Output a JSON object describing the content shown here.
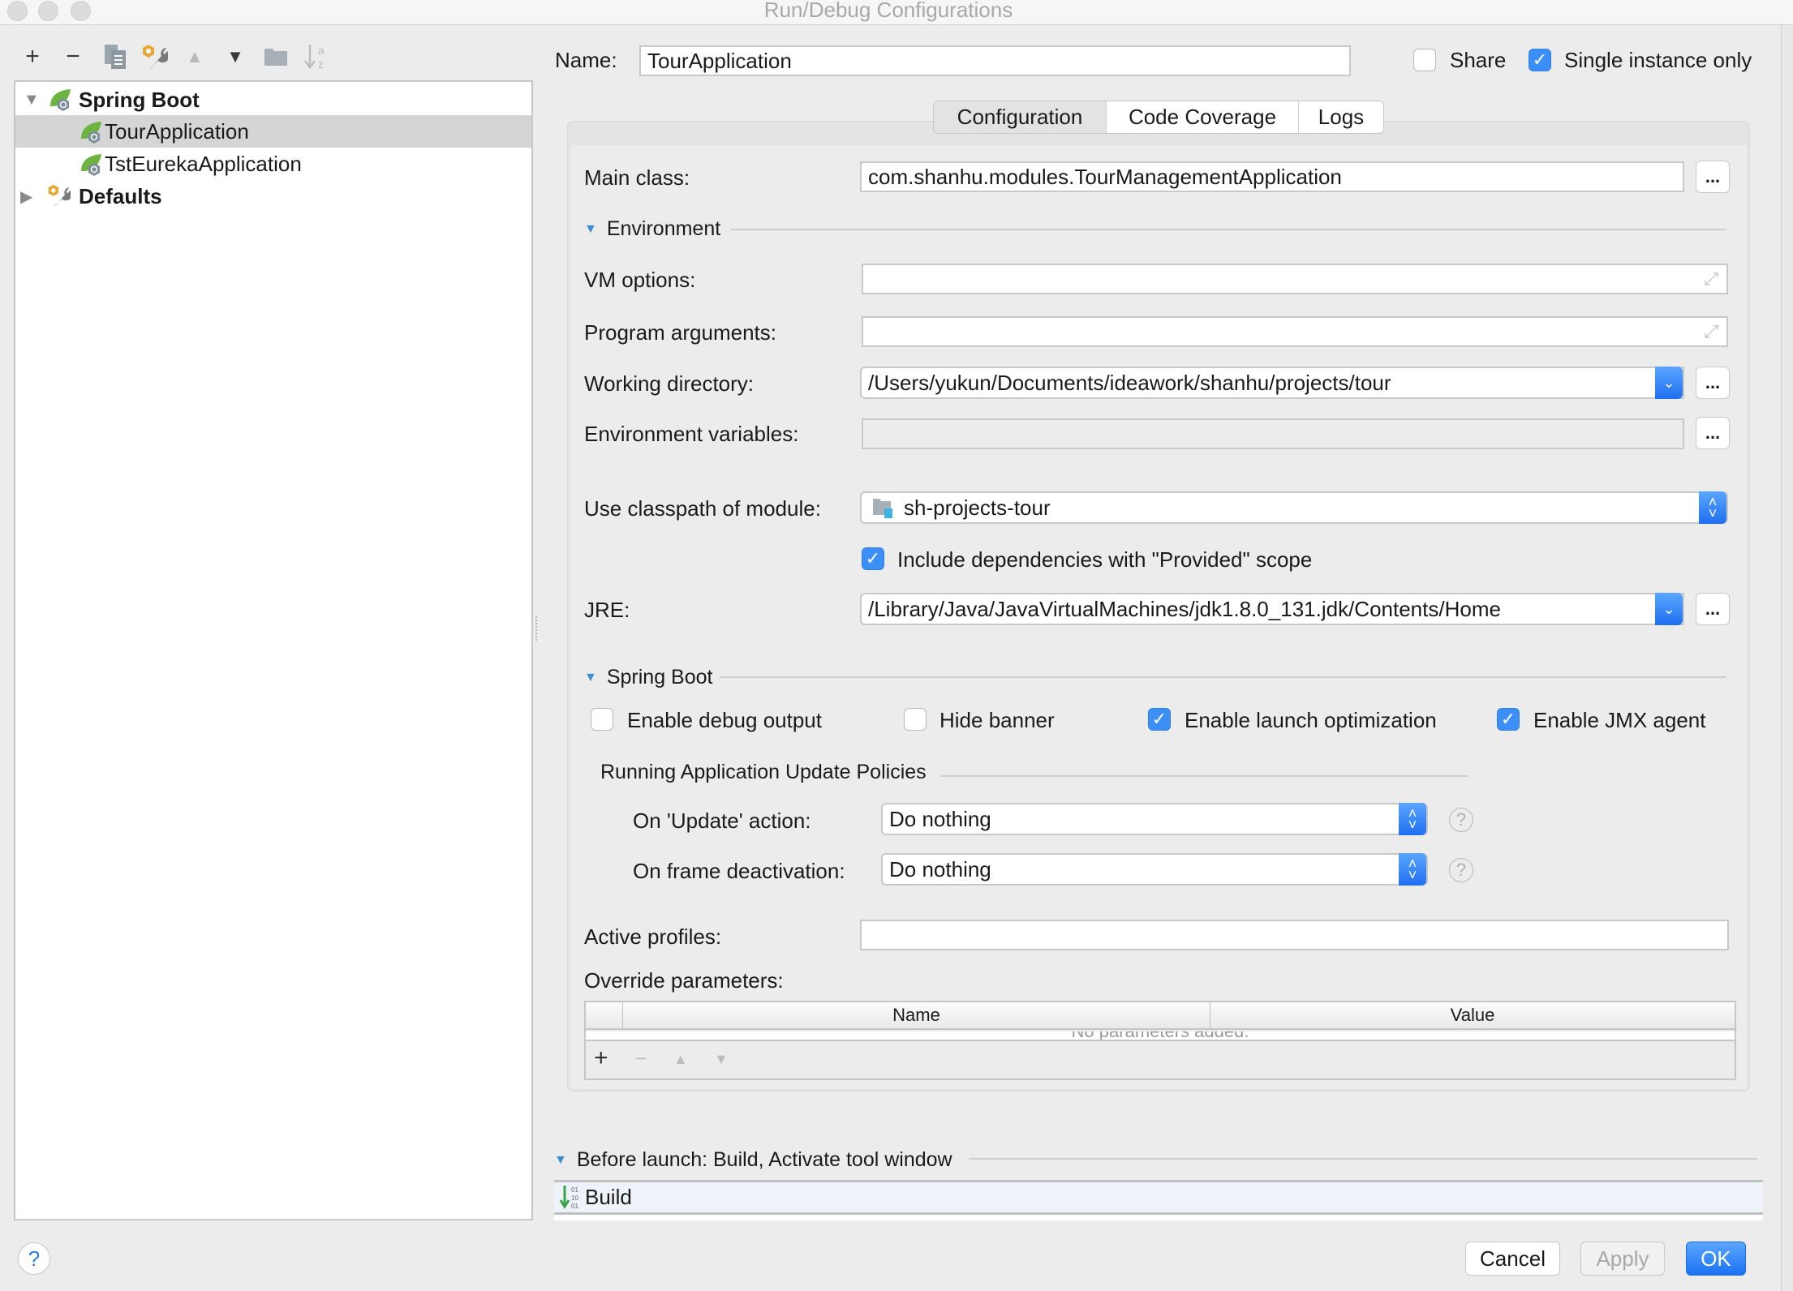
{
  "window": {
    "title": "Run/Debug Configurations"
  },
  "toolbar": {
    "add": "+",
    "remove": "−",
    "copy": "copy",
    "edit_defaults": "edit-defaults",
    "move_up": "▲",
    "move_down": "▼",
    "folder": "folder",
    "sort": "sort-alpha"
  },
  "tree": {
    "items": [
      {
        "label": "Spring Boot",
        "type": "group",
        "expanded": true
      },
      {
        "label": "TourApplication",
        "type": "config",
        "selected": true
      },
      {
        "label": "TstEurekaApplication",
        "type": "config",
        "selected": false
      },
      {
        "label": "Defaults",
        "type": "group",
        "expanded": false
      }
    ]
  },
  "header": {
    "name_label": "Name:",
    "name_value": "TourApplication",
    "share_label": "Share",
    "share_checked": false,
    "single_instance_label": "Single instance only",
    "single_instance_checked": true
  },
  "tabs": [
    {
      "label": "Configuration",
      "active": true
    },
    {
      "label": "Code Coverage",
      "active": false
    },
    {
      "label": "Logs",
      "active": false
    }
  ],
  "config": {
    "main_class_label": "Main class:",
    "main_class_value": "com.shanhu.modules.TourManagementApplication",
    "environment_title": "Environment",
    "vm_options_label": "VM options:",
    "vm_options_value": "",
    "program_args_label": "Program arguments:",
    "program_args_value": "",
    "working_dir_label": "Working directory:",
    "working_dir_value": "/Users/yukun/Documents/ideawork/shanhu/projects/tour",
    "env_vars_label": "Environment variables:",
    "env_vars_value": "",
    "classpath_label": "Use classpath of module:",
    "classpath_value": "sh-projects-tour",
    "include_provided_label": "Include dependencies with \"Provided\" scope",
    "include_provided_checked": true,
    "jre_label": "JRE:",
    "jre_value": "/Library/Java/JavaVirtualMachines/jdk1.8.0_131.jdk/Contents/Home",
    "ellipsis": "...",
    "spring_boot_title": "Spring Boot",
    "options": [
      {
        "label": "Enable debug output",
        "checked": false
      },
      {
        "label": "Hide banner",
        "checked": false
      },
      {
        "label": "Enable launch optimization",
        "checked": true
      },
      {
        "label": "Enable JMX agent",
        "checked": true
      }
    ],
    "update_policies_title": "Running Application Update Policies",
    "on_update_label": "On 'Update' action:",
    "on_update_value": "Do nothing",
    "on_frame_label": "On frame deactivation:",
    "on_frame_value": "Do nothing",
    "help_glyph": "?",
    "active_profiles_label": "Active profiles:",
    "active_profiles_value": "",
    "override_label": "Override parameters:",
    "table_columns": [
      "Name",
      "Value"
    ],
    "table_empty": "No parameters added.",
    "table_add": "+",
    "table_remove": "−",
    "table_up": "▲",
    "table_down": "▼"
  },
  "before_launch": {
    "title": "Before launch: Build, Activate tool window",
    "items": [
      "Build"
    ]
  },
  "footer": {
    "help": "?",
    "cancel": "Cancel",
    "apply": "Apply",
    "ok": "OK"
  },
  "colors": {
    "accent": "#3c8ff7",
    "spring_green": "#6db33f"
  }
}
